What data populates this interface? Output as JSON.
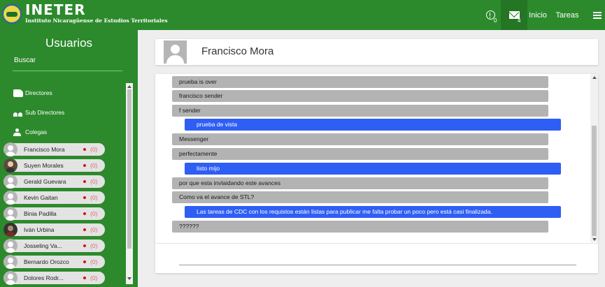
{
  "app": {
    "title": "INETER",
    "subtitle": "Instituto Nicaragüense de Estudios Territoriales"
  },
  "nav": {
    "alerts_count": "0",
    "messages_count": "4",
    "inicio": "Inicio",
    "tareas": "Tareas"
  },
  "sidebar": {
    "title": "Usuarios",
    "search_label": "Buscar",
    "groups": {
      "directores": "Directores",
      "sub_directores": "Sub Directores",
      "colegas": "Colegas"
    },
    "users": [
      {
        "name": "Francisco Mora",
        "count": "(0)"
      },
      {
        "name": "Suyen Morales",
        "count": "(0)"
      },
      {
        "name": "Gerald Guevara",
        "count": "(0)"
      },
      {
        "name": "Kevin Gaitan",
        "count": "(0)"
      },
      {
        "name": "Binia Padilla",
        "count": "(0)"
      },
      {
        "name": "Iván Urbina",
        "count": "(0)"
      },
      {
        "name": "Josseling Va...",
        "count": "(0)"
      },
      {
        "name": "Bernardo Orozco",
        "count": "(0)"
      },
      {
        "name": "Dolores Rodr...",
        "count": "(0)"
      }
    ]
  },
  "chat": {
    "contact_name": "Francisco Mora",
    "messages": [
      {
        "text": "prueba is over",
        "side": "in"
      },
      {
        "text": "francisco sender",
        "side": "in"
      },
      {
        "text": "f sender",
        "side": "in"
      },
      {
        "text": "prueba de vista",
        "side": "out"
      },
      {
        "text": "Messenger",
        "side": "in"
      },
      {
        "text": "perfectamente",
        "side": "in"
      },
      {
        "text": "listo mijo",
        "side": "out"
      },
      {
        "text": "por que esta invlaidando este avances",
        "side": "in"
      },
      {
        "text": "Como va el avance de STL?",
        "side": "in"
      },
      {
        "text": "Las tareas de CDC con los requistos están listas para publicar me falta probar un poco pero está casi finalizada.",
        "side": "out"
      },
      {
        "text": "??????",
        "side": "in"
      }
    ],
    "input_value": ""
  },
  "colors": {
    "brand_green": "#2c8a2c",
    "incoming_bubble": "#b3b3b3",
    "outgoing_bubble": "#2f5ef5",
    "status_dot": "#e01010"
  }
}
